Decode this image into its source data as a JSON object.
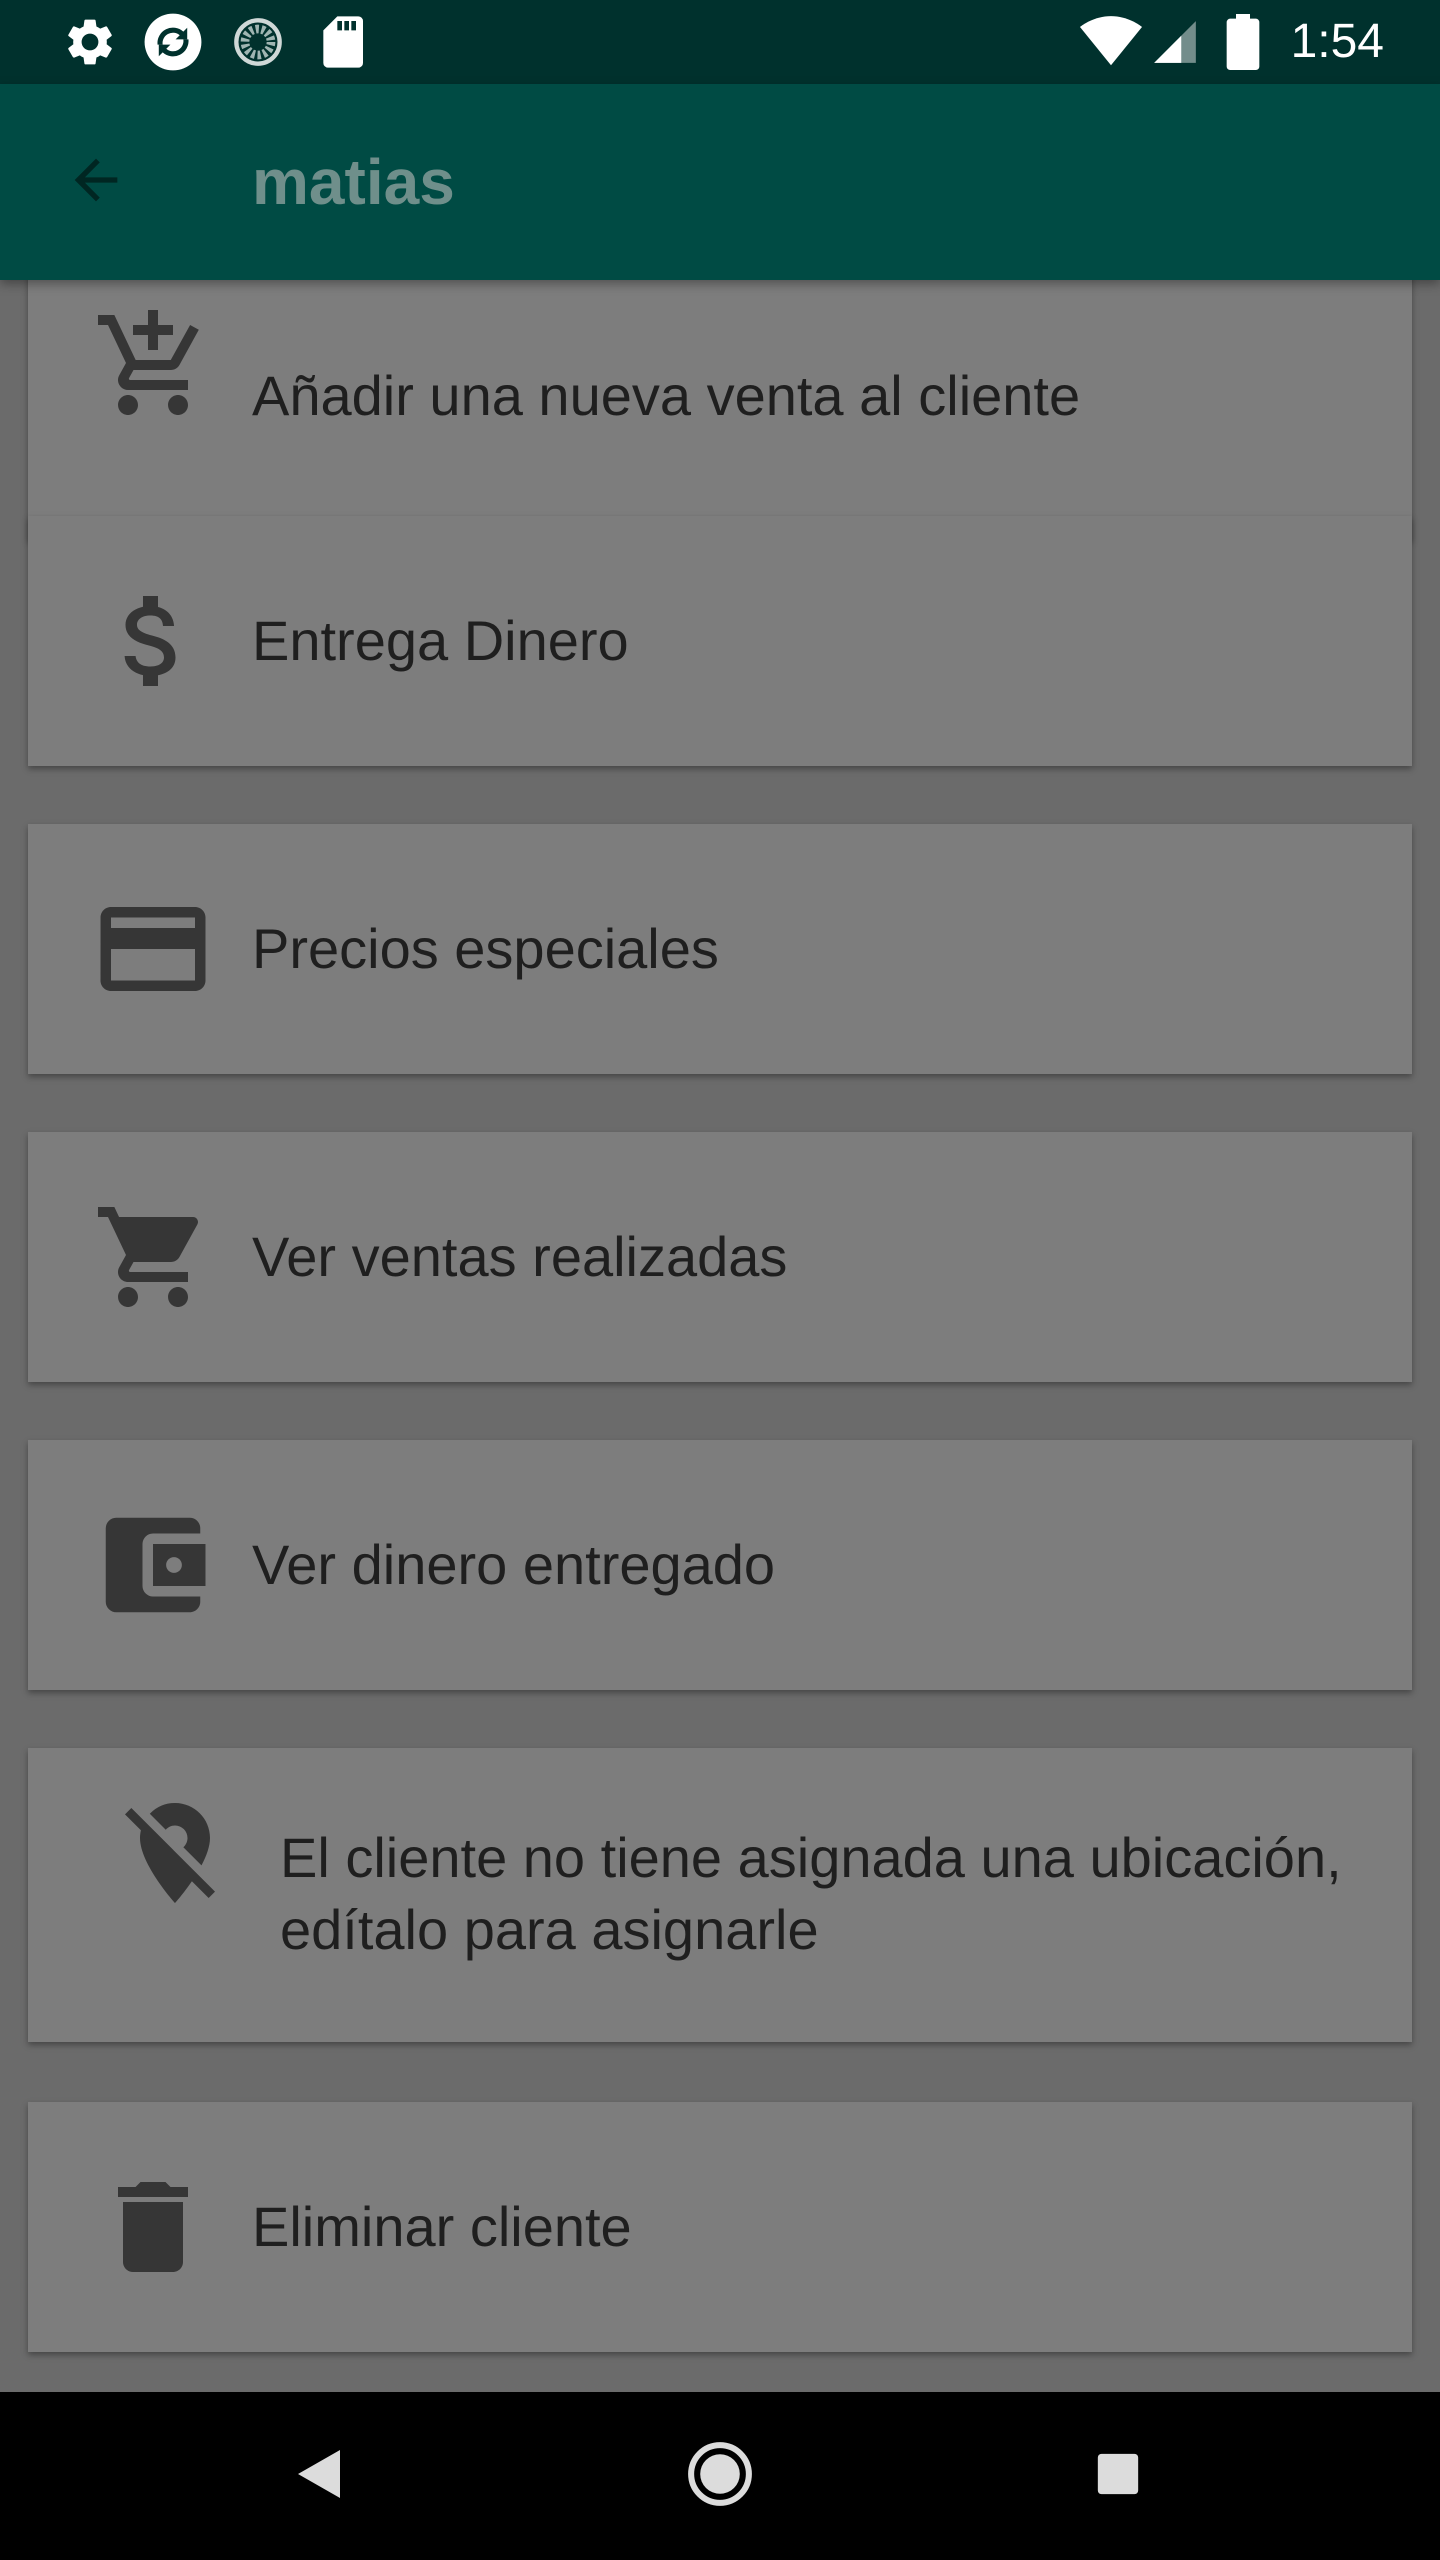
{
  "status_bar": {
    "time": "1:54",
    "icons": [
      "settings-icon",
      "sync-app-icon",
      "loading-app-icon",
      "sd-card-icon",
      "wifi-icon",
      "signal-icon",
      "battery-icon"
    ]
  },
  "app_bar": {
    "title": "matias",
    "back_icon": "arrow-back-icon"
  },
  "menu": {
    "items": [
      {
        "label": "Añadir una nueva venta al cliente",
        "icon": "add-shopping-cart-icon"
      },
      {
        "label": "Entrega Dinero",
        "icon": "dollar-icon"
      },
      {
        "label": "Precios especiales",
        "icon": "credit-card-icon"
      },
      {
        "label": "Ver ventas realizadas",
        "icon": "shopping-cart-icon"
      },
      {
        "label": "Ver dinero entregado",
        "icon": "wallet-icon"
      },
      {
        "label": "El cliente no tiene asignada una ubicación, edítalo para asignarle",
        "icon": "location-off-icon"
      },
      {
        "label": "Eliminar cliente",
        "icon": "delete-icon"
      }
    ]
  },
  "nav_bar": {
    "buttons": [
      "nav-back-icon",
      "nav-home-icon",
      "nav-recents-icon"
    ]
  },
  "colors": {
    "status_bar": "#00312d",
    "app_bar": "#004b44",
    "title_text": "#6f8f8b",
    "background": "#6b6b6b",
    "card": "#7d7d7d",
    "card_text": "#1f1f1f",
    "icon": "#363636"
  }
}
